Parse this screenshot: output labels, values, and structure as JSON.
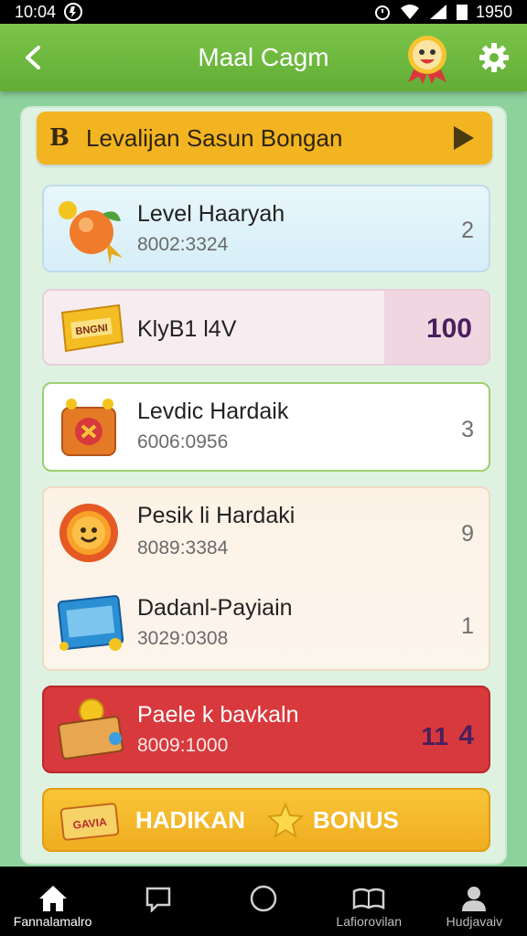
{
  "status_bar": {
    "time": "10:04",
    "battery_text": "1950"
  },
  "header": {
    "title": "Maal Cagm",
    "back_icon": "chevron-left-icon",
    "settings_icon": "gear-icon"
  },
  "banner": {
    "icon_letter": "B",
    "title": "Levalijan Sasun Bongan"
  },
  "rows": [
    {
      "title": "Level Haaryah",
      "subtitle": "8002:3324",
      "value": "2"
    },
    {
      "title": "KlyB1 l4V",
      "subtitle": "",
      "value": "100",
      "icon_text": "BNGNI"
    },
    {
      "title": "Levdic Hardaik",
      "subtitle": "6006:0956",
      "value": "3"
    },
    {
      "title": "Pesik li Hardaki",
      "subtitle": "8089:3384",
      "value": "9"
    },
    {
      "title": "Dadanl-Payiain",
      "subtitle": "3029:0308",
      "value": "1"
    },
    {
      "title": "Paele k bavkaln",
      "subtitle": "8009:1000",
      "value": "11",
      "value2": "4"
    }
  ],
  "bonus": {
    "left_label": "HADIKAN",
    "right_label": "BONUS",
    "badge_text": "GAVIA"
  },
  "tabs": [
    {
      "label": "Fannalamalro",
      "icon": "home-icon",
      "active": true
    },
    {
      "label": "",
      "icon": "chat-icon"
    },
    {
      "label": "",
      "icon": "circle-icon"
    },
    {
      "label": "Lafiorovilan",
      "icon": "book-icon"
    },
    {
      "label": "Hudjavaiv",
      "icon": "profile-icon"
    }
  ],
  "colors": {
    "app_bar": "#6cb83c",
    "banner": "#f3b421",
    "accent_red": "#d8393c",
    "value_purple": "#4a1f5c"
  }
}
